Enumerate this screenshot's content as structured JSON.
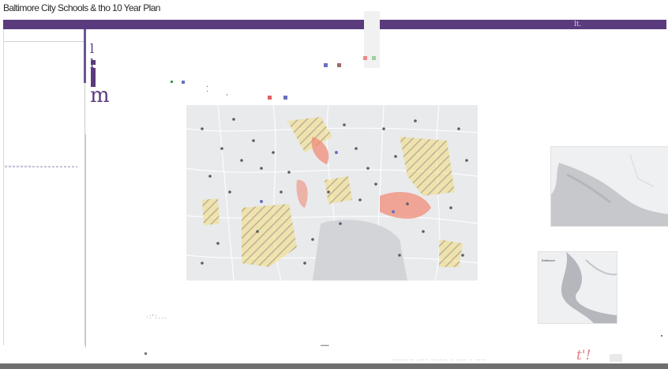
{
  "header": {
    "title": "Baltimore City Schools & tho 10 Year Plan",
    "flag": "lt."
  },
  "sidebar": {
    "caption": "................................"
  },
  "logo": {
    "top": "l l",
    "bottom": "m"
  },
  "colors": {
    "header": "#5a3b7e",
    "footer": "#6f6f6f",
    "map_bg": "#e9eaec",
    "zone_yellow": "#f3dc7a",
    "zone_red": "#f08c7a",
    "accent_pink": "#e07b88"
  },
  "insets": {
    "small_label": "Baltimore"
  },
  "footer": {
    "text": "........ .... ...... . .... . ....",
    "tag": "t'!"
  },
  "misc": {
    "scribble_left": "· : ' : . . .",
    "scribble_mid": "••••••",
    "comma_mark": ","
  }
}
